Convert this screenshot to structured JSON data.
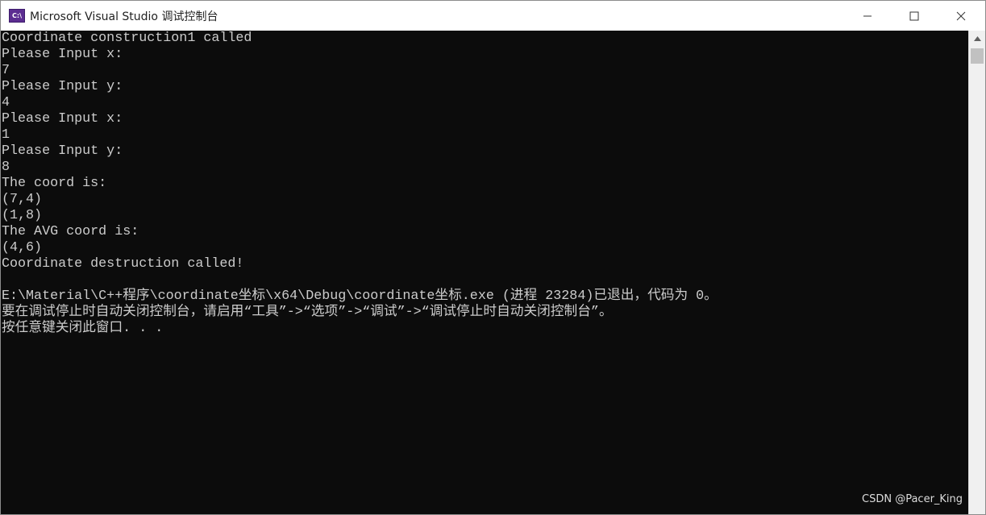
{
  "window": {
    "title": "Microsoft Visual Studio 调试控制台",
    "icon": "visual-studio-icon",
    "icon_text": "C:\\",
    "controls": {
      "minimize": "minimize-icon",
      "maximize": "maximize-icon",
      "close": "close-icon"
    }
  },
  "console": {
    "lines": [
      "Coordinate construction1 called",
      "Please Input x:",
      "7",
      "Please Input y:",
      "4",
      "Please Input x:",
      "1",
      "Please Input y:",
      "8",
      "The coord is:",
      "(7,4)",
      "(1,8)",
      "The AVG coord is:",
      "(4,6)",
      "Coordinate destruction called!",
      "",
      "E:\\Material\\C++程序\\coordinate坐标\\x64\\Debug\\coordinate坐标.exe (进程 23284)已退出，代码为 0。",
      "要在调试停止时自动关闭控制台，请启用“工具”->“选项”->“调试”->“调试停止时自动关闭控制台”。",
      "按任意键关闭此窗口. . ."
    ]
  },
  "watermark": "CSDN @Pacer_King",
  "colors": {
    "console_bg": "#0c0c0c",
    "console_fg": "#cccccc",
    "titlebar_bg": "#ffffff"
  }
}
